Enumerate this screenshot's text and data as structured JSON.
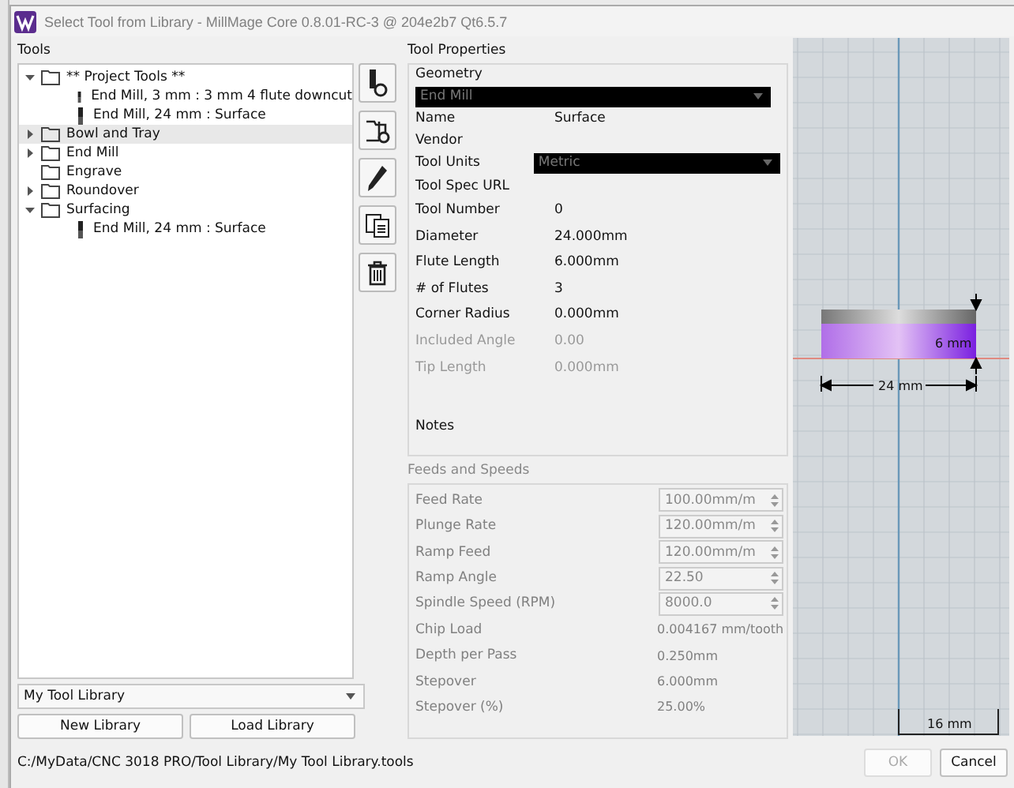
{
  "window": {
    "title": "Select Tool from Library - MillMage Core 0.8.01-RC-3 @ 204e2b7 Qt6.5.7"
  },
  "tools_panel": {
    "label": "Tools",
    "tree": [
      {
        "label": "** Project Tools **",
        "kind": "folder",
        "expanded": true,
        "selected": false,
        "children": [
          {
            "label": "End Mill, 3 mm : 3 mm 4 flute downcut",
            "kind": "tool",
            "selected": false
          },
          {
            "label": "End Mill, 24 mm : Surface",
            "kind": "tool",
            "selected": false
          }
        ]
      },
      {
        "label": "Bowl and Tray",
        "kind": "folder",
        "expanded": false,
        "selected": true
      },
      {
        "label": "End Mill",
        "kind": "folder",
        "expanded": false,
        "selected": false
      },
      {
        "label": "Engrave",
        "kind": "leaf-folder",
        "selected": false
      },
      {
        "label": "Roundover",
        "kind": "folder",
        "expanded": false,
        "selected": false
      },
      {
        "label": "Surfacing",
        "kind": "folder",
        "expanded": true,
        "selected": false,
        "children": [
          {
            "label": "End Mill, 24 mm : Surface",
            "kind": "tool",
            "selected": false
          }
        ]
      }
    ],
    "side_buttons": [
      {
        "kind": "new-tool"
      },
      {
        "kind": "new-folder"
      },
      {
        "kind": "edit"
      },
      {
        "kind": "copy"
      },
      {
        "kind": "delete"
      }
    ],
    "library_select": "My Tool Library",
    "buttons": [
      "New Library",
      "Load Library"
    ]
  },
  "properties": {
    "label": "Tool Properties",
    "geometry": {
      "label": "Geometry",
      "tool_type": "End Mill",
      "rows": [
        {
          "label": "Name",
          "kind": "text",
          "value": "Surface",
          "disabled": false
        },
        {
          "label": "Vendor",
          "kind": "text",
          "value": "",
          "disabled": false
        },
        {
          "label": "Tool Units",
          "kind": "dropdown",
          "value": "Metric",
          "disabled": false
        },
        {
          "label": "Tool Spec URL",
          "kind": "text",
          "value": "",
          "disabled": false
        },
        {
          "label": "Tool Number",
          "kind": "text",
          "value": "0",
          "disabled": false
        },
        {
          "label": "Diameter",
          "kind": "text",
          "value": "24.000mm",
          "disabled": false
        },
        {
          "label": "Flute Length",
          "kind": "text",
          "value": "6.000mm",
          "disabled": false
        },
        {
          "label": "# of Flutes",
          "kind": "text",
          "value": "3",
          "disabled": false
        },
        {
          "label": "Corner Radius",
          "kind": "text",
          "value": "0.000mm",
          "disabled": false
        },
        {
          "label": "Included Angle",
          "kind": "text",
          "value": "0.00",
          "disabled": true
        },
        {
          "label": "Tip Length",
          "kind": "text",
          "value": "0.000mm",
          "disabled": true
        }
      ],
      "notes_label": "Notes"
    },
    "feeds": {
      "label": "Feeds and Speeds",
      "rows": [
        {
          "label": "Feed Rate",
          "kind": "spin",
          "value": "100.00mm/m"
        },
        {
          "label": "Plunge Rate",
          "kind": "spin",
          "value": "120.00mm/m"
        },
        {
          "label": "Ramp Feed",
          "kind": "spin",
          "value": "120.00mm/m"
        },
        {
          "label": "Ramp Angle",
          "kind": "spin",
          "value": "22.50"
        },
        {
          "label": "Spindle Speed (RPM)",
          "kind": "spin",
          "value": "8000.0"
        },
        {
          "label": "Chip Load",
          "kind": "text",
          "value": "0.004167 mm/tooth"
        },
        {
          "label": "Depth per Pass",
          "kind": "text",
          "value": "0.250mm"
        },
        {
          "label": "Stepover",
          "kind": "text",
          "value": "6.000mm"
        },
        {
          "label": "Stepover (%)",
          "kind": "text",
          "value": "25.00%"
        }
      ]
    }
  },
  "preview": {
    "height_label": "6 mm",
    "diameter_label": "24 mm",
    "scale_label": "16 mm"
  },
  "status_path": "C:/MyData/CNC 3018 PRO/Tool Library/My Tool Library.tools",
  "dialog_buttons": [
    {
      "label": "OK",
      "disabled": true
    },
    {
      "label": "Cancel",
      "disabled": false
    }
  ]
}
